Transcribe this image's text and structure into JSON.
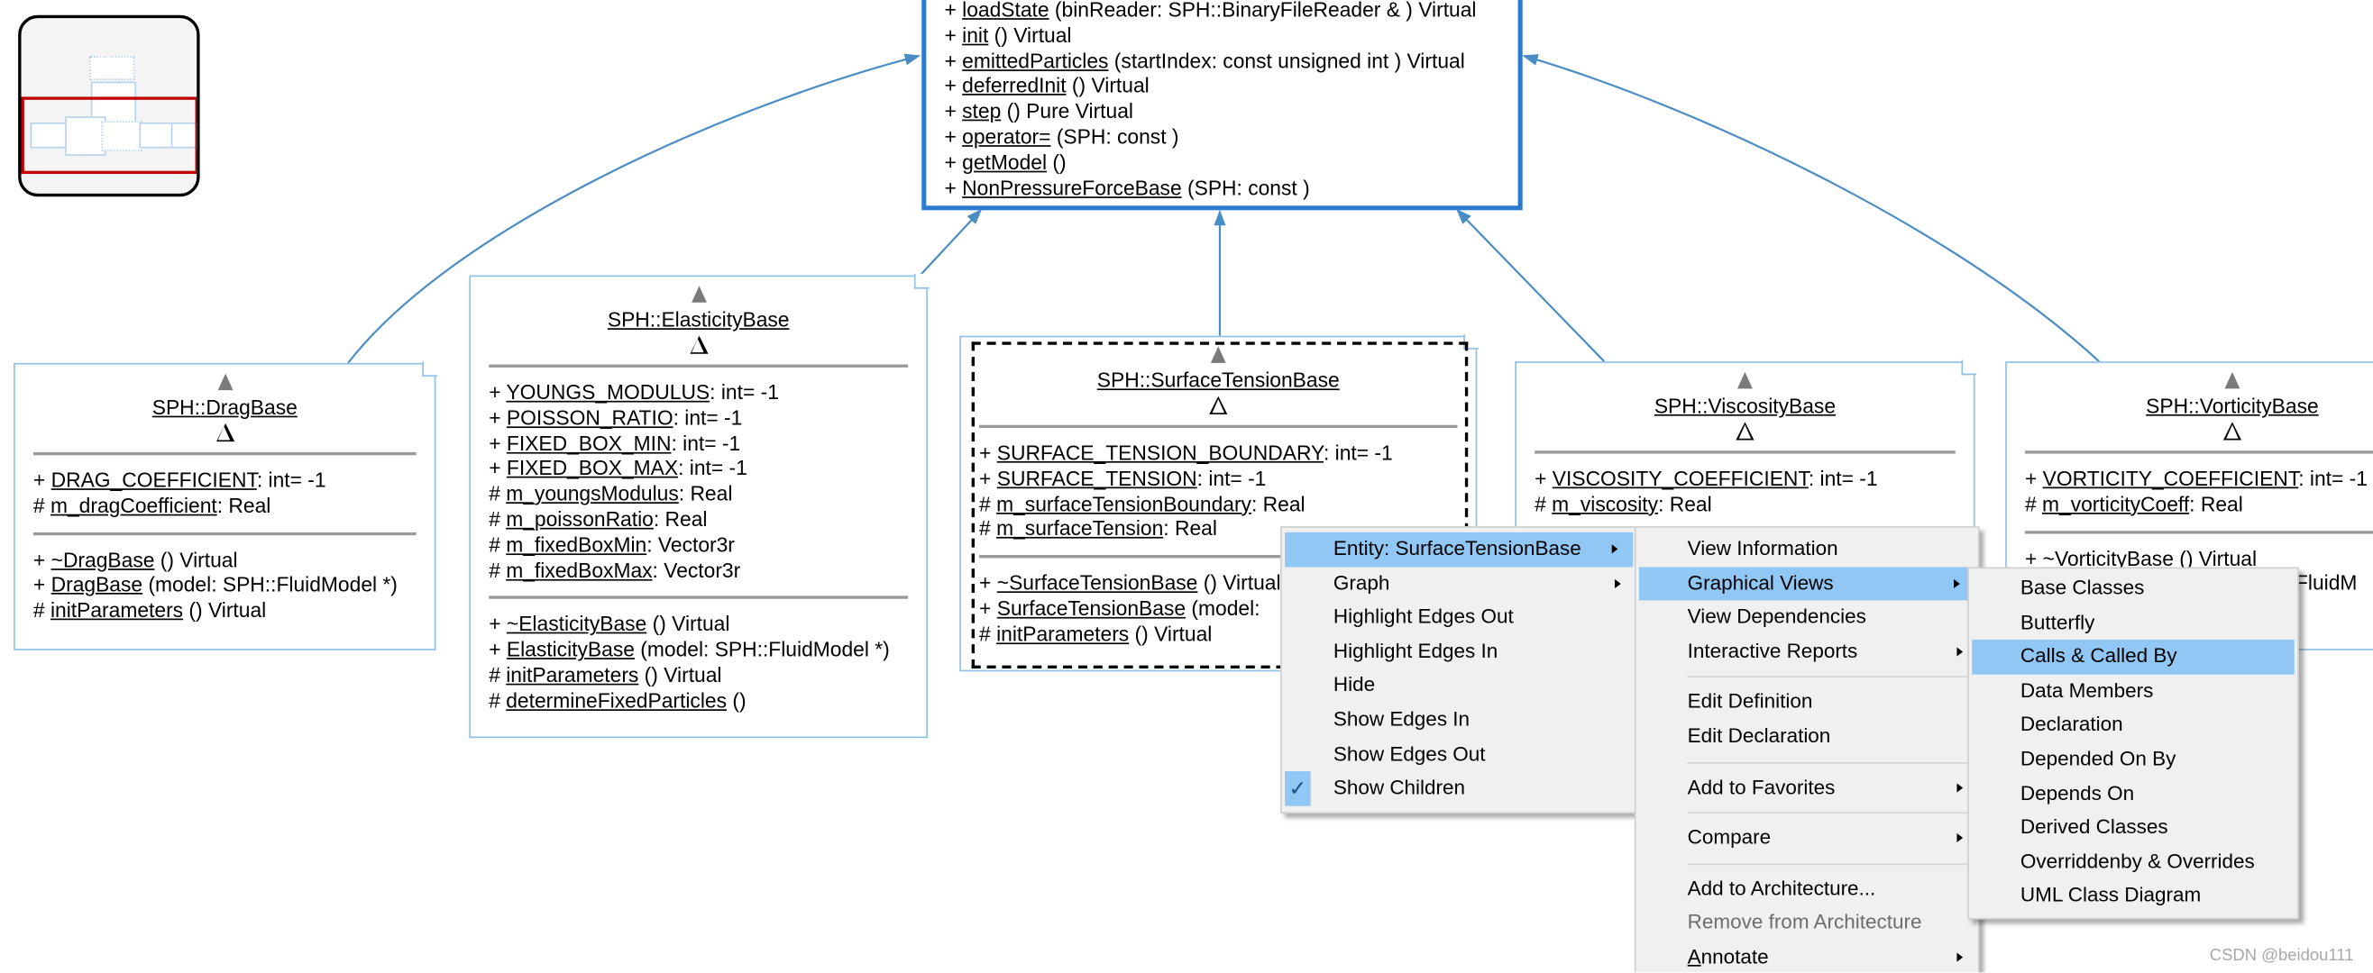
{
  "minimap": {
    "label": "diagram overview"
  },
  "main_class": {
    "methods": [
      {
        "vis": "+",
        "name": "loadState",
        "rest": " (binReader: SPH::BinaryFileReader & ) Virtual"
      },
      {
        "vis": "+",
        "name": "init",
        "rest": " () Virtual"
      },
      {
        "vis": "+",
        "name": "emittedParticles",
        "rest": " (startIndex: const unsigned int ) Virtual"
      },
      {
        "vis": "+",
        "name": "deferredInit",
        "rest": " () Virtual"
      },
      {
        "vis": "+",
        "name": "step",
        "rest": " () Pure Virtual"
      },
      {
        "vis": "+",
        "name": "operator=",
        "rest": " (SPH: const )"
      },
      {
        "vis": "+",
        "name": "getModel",
        "rest": " ()"
      },
      {
        "vis": "+",
        "name": "NonPressureForceBase",
        "rest": " (SPH: const )"
      }
    ]
  },
  "classes": [
    {
      "id": "drag",
      "title": "SPH::DragBase",
      "attributes": [
        {
          "vis": "+",
          "name": "DRAG_COEFFICIENT",
          "rest": ": int= -1"
        },
        {
          "vis": "#",
          "name": "m_dragCoefficient",
          "rest": ": Real"
        }
      ],
      "methods": [
        {
          "vis": "+",
          "name": "~DragBase",
          "rest": " () Virtual"
        },
        {
          "vis": "+",
          "name": "DragBase",
          "rest": " (model: SPH::FluidModel *)"
        },
        {
          "vis": "#",
          "name": "initParameters",
          "rest": " () Virtual"
        }
      ]
    },
    {
      "id": "elasticity",
      "title": "SPH::ElasticityBase",
      "attributes": [
        {
          "vis": "+",
          "name": "YOUNGS_MODULUS",
          "rest": ": int= -1"
        },
        {
          "vis": "+",
          "name": "POISSON_RATIO",
          "rest": ": int= -1"
        },
        {
          "vis": "+",
          "name": "FIXED_BOX_MIN",
          "rest": ": int= -1"
        },
        {
          "vis": "+",
          "name": "FIXED_BOX_MAX",
          "rest": ": int= -1"
        },
        {
          "vis": "#",
          "name": "m_youngsModulus",
          "rest": ": Real"
        },
        {
          "vis": "#",
          "name": "m_poissonRatio",
          "rest": ": Real"
        },
        {
          "vis": "#",
          "name": "m_fixedBoxMin",
          "rest": ": Vector3r"
        },
        {
          "vis": "#",
          "name": "m_fixedBoxMax",
          "rest": ": Vector3r"
        }
      ],
      "methods": [
        {
          "vis": "+",
          "name": "~ElasticityBase",
          "rest": " () Virtual"
        },
        {
          "vis": "+",
          "name": "ElasticityBase",
          "rest": " (model: SPH::FluidModel *)"
        },
        {
          "vis": "#",
          "name": "initParameters",
          "rest": " () Virtual"
        },
        {
          "vis": "#",
          "name": "determineFixedParticles",
          "rest": " ()"
        }
      ]
    },
    {
      "id": "surface-tension",
      "title": "SPH::SurfaceTensionBase",
      "selected": true,
      "attributes": [
        {
          "vis": "+",
          "name": "SURFACE_TENSION_BOUNDARY",
          "rest": ": int= -1"
        },
        {
          "vis": "+",
          "name": "SURFACE_TENSION",
          "rest": ": int= -1"
        },
        {
          "vis": "#",
          "name": "m_surfaceTensionBoundary",
          "rest": ": Real"
        },
        {
          "vis": "#",
          "name": "m_surfaceTension",
          "rest": ": Real"
        }
      ],
      "methods": [
        {
          "vis": "+",
          "name": "~SurfaceTensionBase",
          "rest": " () Virtual"
        },
        {
          "vis": "+",
          "name": "SurfaceTensionBase",
          "rest": " (model:"
        },
        {
          "vis": "#",
          "name": "initParameters",
          "rest": " () Virtual"
        }
      ]
    },
    {
      "id": "viscosity",
      "title": "SPH::ViscosityBase",
      "attributes": [
        {
          "vis": "+",
          "name": "VISCOSITY_COEFFICIENT",
          "rest": ": int= -1"
        },
        {
          "vis": "#",
          "name": "m_viscosity",
          "rest": ": Real"
        }
      ],
      "methods": []
    },
    {
      "id": "vorticity",
      "title": "SPH::VorticityBase",
      "attributes": [
        {
          "vis": "+",
          "name": "VORTICITY_COEFFICIENT",
          "rest": ": int= -1"
        },
        {
          "vis": "#",
          "name": "m_vorticityCoeff",
          "rest": ": Real"
        }
      ],
      "methods": [
        {
          "vis": "+",
          "name": "~VorticityBase",
          "rest": " () Virtual"
        },
        {
          "vis": "+",
          "name": "VorticityBase",
          "rest": " (model: SPH::FluidM"
        }
      ]
    }
  ],
  "context_menu": {
    "items": [
      {
        "label": "Entity: SurfaceTensionBase",
        "submenu": true,
        "highlighted": true
      },
      {
        "label": "Graph",
        "submenu": true
      },
      {
        "label": "Highlight Edges Out"
      },
      {
        "label": "Highlight Edges In"
      },
      {
        "label": "Hide"
      },
      {
        "label": "Show Edges In"
      },
      {
        "label": "Show Edges Out"
      },
      {
        "label": "Show Children",
        "checked": true
      }
    ]
  },
  "entity_submenu": {
    "items": [
      {
        "label": "View Information"
      },
      {
        "label": "Graphical Views",
        "submenu": true,
        "highlighted": true
      },
      {
        "label": "View Dependencies"
      },
      {
        "label": "Interactive Reports",
        "submenu": true
      },
      {
        "separator": true
      },
      {
        "label": "Edit Definition"
      },
      {
        "label": "Edit Declaration"
      },
      {
        "separator": true
      },
      {
        "label": "Add to Favorites",
        "submenu": true
      },
      {
        "separator": true
      },
      {
        "label": "Compare",
        "submenu": true
      },
      {
        "separator": true
      },
      {
        "label": "Add to Architecture..."
      },
      {
        "label": "Remove from Architecture",
        "disabled": true
      },
      {
        "label": "Annotate",
        "submenu": true
      }
    ]
  },
  "graphical_views_submenu": {
    "items": [
      {
        "label": "Base Classes"
      },
      {
        "label": "Butterfly"
      },
      {
        "label": "Calls & Called By",
        "highlighted": true
      },
      {
        "label": "Data Members"
      },
      {
        "label": "Declaration"
      },
      {
        "label": "Depended On By"
      },
      {
        "label": "Depends On"
      },
      {
        "label": "Derived Classes"
      },
      {
        "label": "Overriddenby & Overrides"
      },
      {
        "label": "UML Class Diagram"
      }
    ]
  },
  "watermark": "CSDN @beidou111",
  "colors": {
    "selected_border": "#2a7bd0",
    "class_border": "#8ec0e8",
    "edge": "#4a8cc4",
    "menu_highlight": "#91c7f4",
    "minimap_viewport": "#c00000"
  }
}
